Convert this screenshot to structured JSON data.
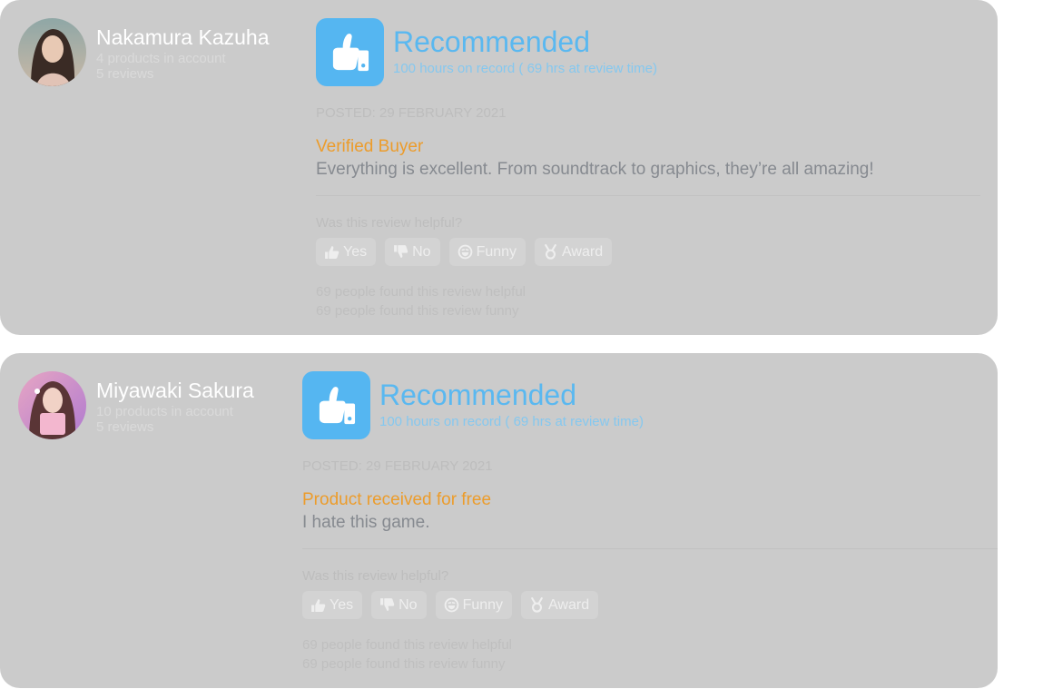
{
  "reviews": [
    {
      "user": {
        "name": "Nakamura Kazuha",
        "products": "4 products in account",
        "reviews": "5 reviews"
      },
      "recommendation": "Recommended",
      "hours": "100 hours on record ( 69 hrs at review time)",
      "posted": "POSTED: 29 FEBRUARY 2021",
      "status": "Verified Buyer",
      "comment": "Everything is excellent. From soundtrack to graphics, they’re all amazing!",
      "helpful_question": "Was this review helpful?",
      "buttons": {
        "yes": "Yes",
        "no": "No",
        "funny": "Funny",
        "award": "Award"
      },
      "helpful_count": "69 people found this review helpful",
      "funny_count": "69 people found this review funny"
    },
    {
      "user": {
        "name": "Miyawaki Sakura",
        "products": "10 products in account",
        "reviews": "5 reviews"
      },
      "recommendation": "Recommended",
      "hours": "100 hours on record ( 69 hrs at review time)",
      "posted": "POSTED: 29 FEBRUARY 2021",
      "status": "Product received for free",
      "comment": "I hate this game.",
      "helpful_question": "Was this review helpful?",
      "buttons": {
        "yes": "Yes",
        "no": "No",
        "funny": "Funny",
        "award": "Award"
      },
      "helpful_count": "69 people found this review helpful",
      "funny_count": "69 people found this review funny"
    }
  ],
  "colors": {
    "card_bg": "#cbcbcb",
    "accent_blue": "#55b6f1",
    "status_orange": "#ec9c2b",
    "comment_gray": "#868a90"
  },
  "icons": {
    "recommend": "thumbs-up-icon",
    "yes": "thumbs-up-icon",
    "no": "thumbs-down-icon",
    "funny": "laugh-icon",
    "award": "medal-icon"
  }
}
